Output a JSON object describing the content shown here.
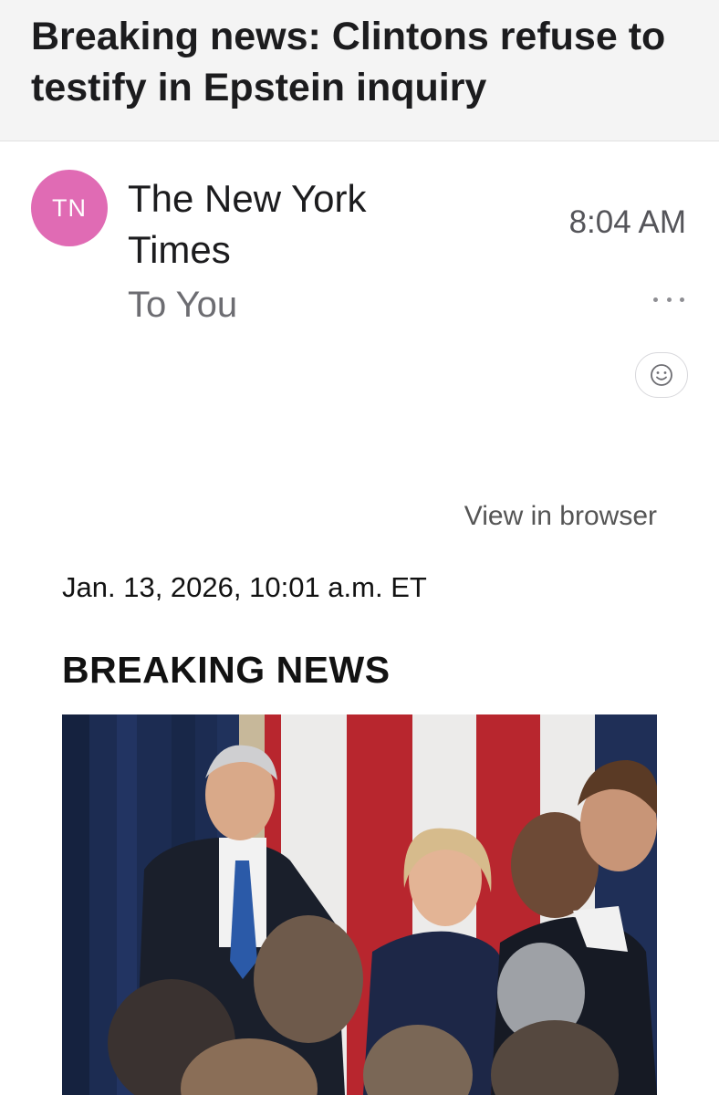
{
  "email": {
    "subject": "Breaking news: Clintons refuse to testify in Epstein inquiry",
    "sender_initials": "TN",
    "sender_name": "The New York Times",
    "recipient": "To You",
    "time": "8:04 AM"
  },
  "icons": {
    "more": "more-dots-icon",
    "reaction": "smiley-icon"
  },
  "colors": {
    "avatar": "#e06bb4",
    "header_bg": "#f4f4f4"
  },
  "body": {
    "view_in_browser": "View in browser",
    "dateline": "Jan. 13, 2026, 10:01 a.m. ET",
    "kicker": "BREAKING NEWS"
  }
}
